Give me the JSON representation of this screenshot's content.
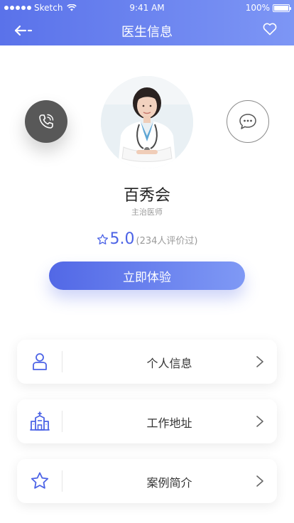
{
  "status_bar": {
    "carrier": "Sketch",
    "time": "9:41 AM",
    "battery": "100%"
  },
  "nav": {
    "title": "医生信息"
  },
  "doctor": {
    "name": "百秀会",
    "title": "主治医师",
    "rating": "5.0",
    "review_count": "(234人评价过)"
  },
  "cta": {
    "label": "立即体验"
  },
  "menu": [
    {
      "label": "个人信息",
      "icon": "person-icon"
    },
    {
      "label": "工作地址",
      "icon": "hospital-icon"
    },
    {
      "label": "案例简介",
      "icon": "star-icon"
    }
  ],
  "colors": {
    "brand_start": "#5a72ea",
    "brand_end": "#7d96f5",
    "accent": "#4c63e6"
  }
}
